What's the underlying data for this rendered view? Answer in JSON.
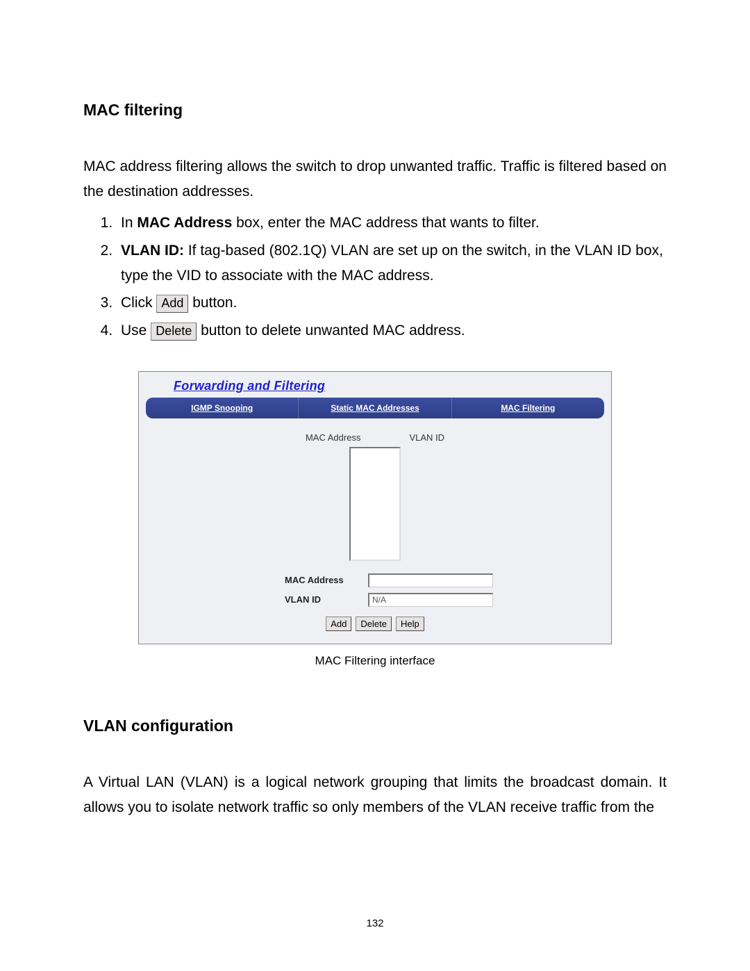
{
  "section1_title": "MAC filtering",
  "intro": "MAC address filtering allows the switch to drop unwanted traffic. Traffic is filtered based on the destination addresses.",
  "steps": {
    "s1_a": "In ",
    "s1_bold": "MAC Address",
    "s1_b": " box, enter the MAC address that wants to filter.",
    "s2_bold": "VLAN ID:",
    "s2_rest": " If tag-based (802.1Q) VLAN are set up on the switch, in the VLAN ID box, type the VID to associate with the MAC address.",
    "s3_a": "Click ",
    "s3_btn": "Add",
    "s3_b": " button.",
    "s4_a": "Use ",
    "s4_btn": "Delete",
    "s4_b": " button to delete unwanted MAC address."
  },
  "ui": {
    "panel_title": "Forwarding and Filtering",
    "tabs": [
      "IGMP Snooping",
      "Static MAC Addresses",
      "MAC Filtering"
    ],
    "col_mac": "MAC Address",
    "col_vlan": "VLAN ID",
    "label_mac": "MAC Address",
    "label_vlan": "VLAN ID",
    "vlan_value": "N/A",
    "buttons": [
      "Add",
      "Delete",
      "Help"
    ]
  },
  "caption": "MAC Filtering interface",
  "section2_title": "VLAN configuration",
  "section2_body": "A Virtual LAN (VLAN) is a logical network grouping that limits the broadcast domain. It allows you to isolate network traffic so only members of the VLAN receive traffic from the",
  "page_number": "132"
}
